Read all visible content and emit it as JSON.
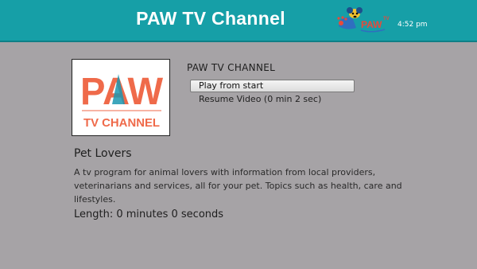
{
  "header": {
    "title": "PAW TV Channel",
    "time": "4:52 pm",
    "logo_text": "PAW",
    "logo_sup": "TV",
    "color": "#169fa7"
  },
  "poster": {
    "line1": "PAW",
    "line2": "TV CHANNEL",
    "accent_color": "#ef6a4a",
    "secondary_color": "#1c96b0"
  },
  "details": {
    "heading": "PAW TV CHANNEL",
    "menu": [
      {
        "label": "Play from start",
        "selected": true
      },
      {
        "label": "Resume Video (0 min 2 sec)",
        "selected": false
      }
    ]
  },
  "description": {
    "title": "Pet Lovers",
    "body": "A tv program for animal lovers with information from local providers, veterinarians and services, all for your pet. Topics such as health, care and lifestyles.",
    "length": "Length: 0 minutes 0 seconds"
  }
}
